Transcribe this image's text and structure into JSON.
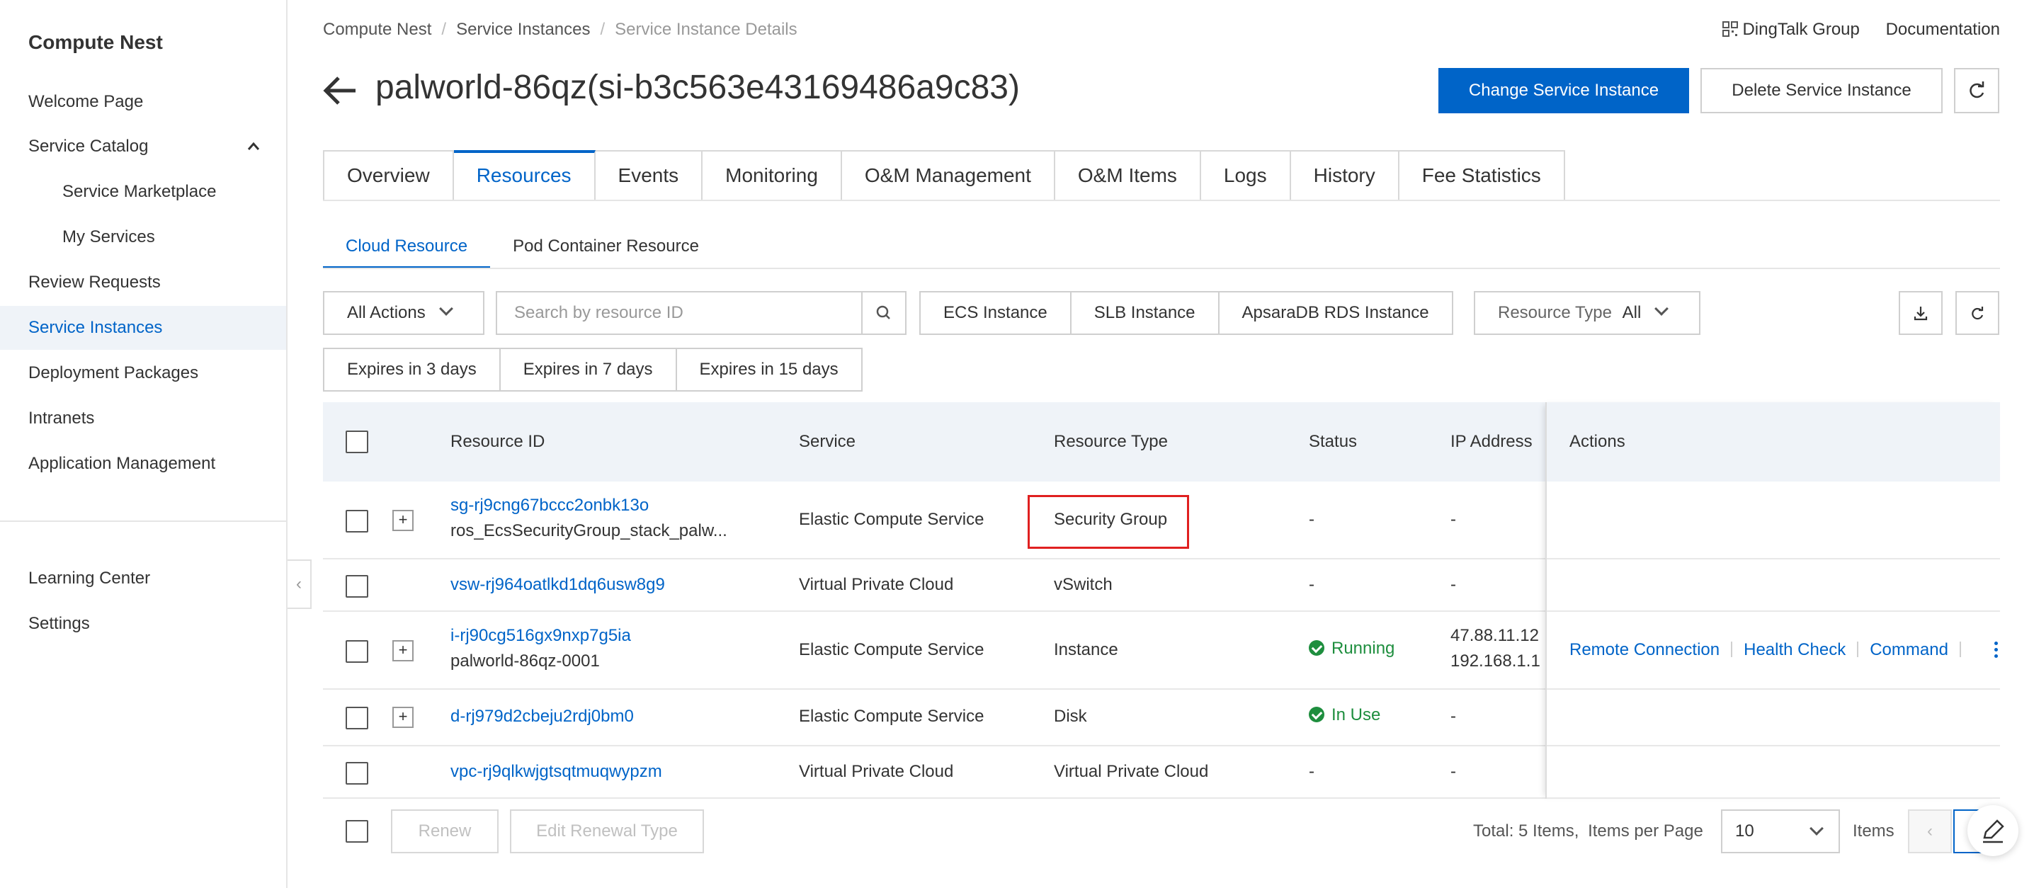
{
  "sidebar": {
    "title": "Compute Nest",
    "items": [
      {
        "label": "Welcome Page"
      },
      {
        "label": "Service Catalog"
      },
      {
        "label": "Service Marketplace"
      },
      {
        "label": "My Services"
      },
      {
        "label": "Review Requests"
      },
      {
        "label": "Service Instances"
      },
      {
        "label": "Deployment Packages"
      },
      {
        "label": "Intranets"
      },
      {
        "label": "Application Management"
      },
      {
        "label": "Learning Center"
      },
      {
        "label": "Settings"
      }
    ],
    "active": "Service Instances"
  },
  "breadcrumb": [
    "Compute Nest",
    "Service Instances",
    "Service Instance Details"
  ],
  "top_links": {
    "dingtalk": "DingTalk Group",
    "docs": "Documentation"
  },
  "page": {
    "title": "palworld-86qz(si-b3c563e43169486a9c83)",
    "change_button": "Change Service Instance",
    "delete_button": "Delete Service Instance"
  },
  "tabs": [
    "Overview",
    "Resources",
    "Events",
    "Monitoring",
    "O&M Management",
    "O&M Items",
    "Logs",
    "History",
    "Fee Statistics"
  ],
  "active_tab": "Resources",
  "subtabs": [
    "Cloud Resource",
    "Pod Container Resource"
  ],
  "filters": {
    "all_actions": "All Actions",
    "search_placeholder": "Search by resource ID",
    "type_buttons": [
      "ECS Instance",
      "SLB Instance",
      "ApsaraDB RDS Instance"
    ],
    "resource_type_label": "Resource Type",
    "resource_type_value": "All",
    "expiry_buttons": [
      "Expires in 3 days",
      "Expires in 7 days",
      "Expires in 15 days"
    ]
  },
  "table": {
    "headers": [
      "Resource ID",
      "Service",
      "Resource Type",
      "Status",
      "IP Address",
      "Actions"
    ],
    "rows": [
      {
        "id": "sg-rj9cng67bccc2onbk13o",
        "name": "ros_EcsSecurityGroup_stack_palw...",
        "service": "Elastic Compute Service",
        "type": "Security Group",
        "status": "-",
        "ip1": "-",
        "ip2": ""
      },
      {
        "id": "vsw-rj964oatlkd1dq6usw8g9",
        "name": "",
        "service": "Virtual Private Cloud",
        "type": "vSwitch",
        "status": "-",
        "ip1": "-",
        "ip2": ""
      },
      {
        "id": "i-rj90cg516gx9nxp7g5ia",
        "name": "palworld-86qz-0001",
        "service": "Elastic Compute Service",
        "type": "Instance",
        "status": "Running",
        "ip1": "47.88.11.12",
        "ip2": "192.168.1.1"
      },
      {
        "id": "d-rj979d2cbeju2rdj0bm0",
        "name": "",
        "service": "Elastic Compute Service",
        "type": "Disk",
        "status": "In Use",
        "ip1": "-",
        "ip2": ""
      },
      {
        "id": "vpc-rj9qlkwjgtsqtmuqwypzm",
        "name": "",
        "service": "Virtual Private Cloud",
        "type": "Virtual Private Cloud",
        "status": "-",
        "ip1": "-",
        "ip2": ""
      }
    ],
    "row_actions": [
      "Remote Connection",
      "Health Check",
      "Command"
    ]
  },
  "footer": {
    "renew": "Renew",
    "edit_renewal": "Edit Renewal Type",
    "total": "Total: 5 Items,",
    "per_page_label": "Items per Page",
    "per_page_value": "10",
    "items_label": "Items",
    "current_page": "1"
  },
  "colors": {
    "accent": "#0064c8",
    "success": "#1e8e3e",
    "highlight": "#e02020"
  }
}
